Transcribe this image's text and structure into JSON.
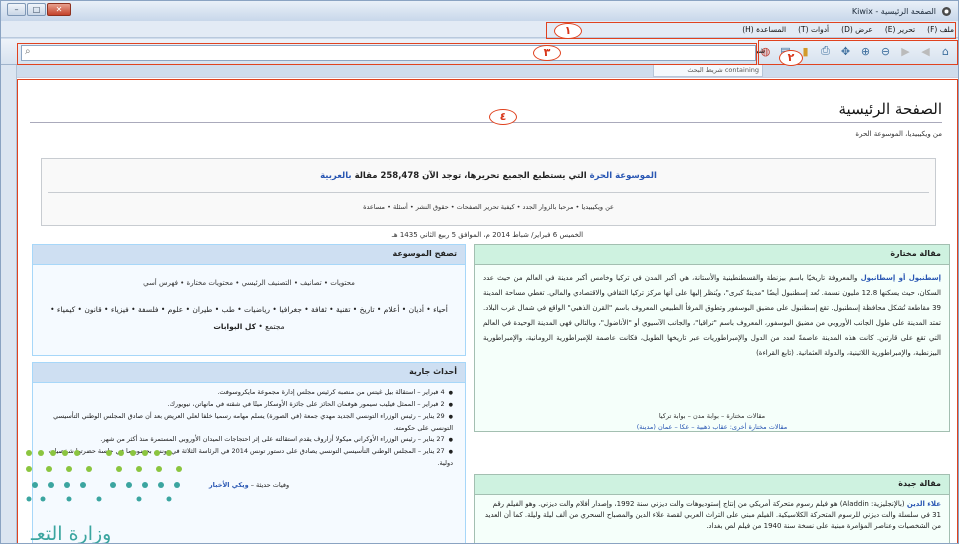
{
  "window": {
    "title": "الصفحة الرئيسية - Kiwix",
    "buttons": {
      "minimize": "–",
      "maximize": "□",
      "close": "✕"
    }
  },
  "menubar": {
    "items": [
      "ملف (F)",
      "تحرير (E)",
      "عرض (D)",
      "أدوات (T)",
      "المساعدة (H)"
    ]
  },
  "toolbar": {
    "search_label": "شريط البحث",
    "search_placeholder": "",
    "suggestion": "containing  شريط البحث"
  },
  "callouts": {
    "menu": "١",
    "toolbar": "٢",
    "search": "٣",
    "content": "٤"
  },
  "page": {
    "title": "الصفحة الرئيسية",
    "subtitle": "من ويكيبيديا، الموسوعة الحرة",
    "welcome": {
      "line1_link": "الموسوعة الحرة",
      "line1_text": "التي يستطيع الجميع تحريرها، توجد الآن 258,478 مقالة",
      "line1_lang": "بالعربية",
      "line2": "عن ويكيبيديا • مرحبا بالزوار الجدد • كيفية تحرير الصفحات • حقوق النشر • أسئلة • مساعدة"
    },
    "date": "الخميس 6 فبراير/ شباط 2014 م، الموافق 5 ربيع الثاني 1435 هـ"
  },
  "featured": {
    "header": "مقالة مختارة",
    "lead": "إسطنبول أو إسطانبول",
    "body": "والمعروفة تاريخيًا باسم بيزنطة والقسطنطينية والأستانة، هي أكبر المدن في تركيا وخامس أكبر مدينة في العالم من حيث عدد السكان، حيث يسكنها 12.8 مليون نسمة. تُعد إسطنبول أيضًا \"مدينةً كبرى\"، ويُنظر إليها على أنها مركز تركيا الثقافي والاقتصادي والمالي. تغطي مساحة المدينة 39 مقاطعة تُشكل محافظة إسطنبول. تقع إسطنبول على مضيق البوسفور وتطوق المرفأ الطبيعي المعروف باسم \"القرن الذهبي\" الواقع في شمال غرب البلاد. تمتد المدينة على طول الجانب الأوروبي من مضيق البوسفور، المعروف باسم \"تراقيا\"، والجانب الآسيوي أو \"الأناضول\"، وبالتالي فهي المدينة الوحيدة في العالم التي تقع على قارتين. كانت هذه المدينة عاصمةً لعدد من الدول والإمبراطوريات عبر تاريخها الطويل، فكانت عاصمة للإمبراطورية الرومانية، والإمبراطورية البيزنطية، والإمبراطورية اللاتينية، والدولة العثمانية. (تابع القراءة)",
    "links1": "مقالات مختارة – بوابة مدن – بوابة تركيا",
    "links2": "مقالات مختارة أخرى: عقاب ذهبية – عكا – عمان (مدينة)"
  },
  "good": {
    "header": "مقالة جيدة",
    "lead": "علاء الدين",
    "body": "(بالإنجليزية: Aladdin) هو فيلم رسوم متحركة أمريكي من إنتاج إستوديوهات والت ديزني سنة 1992، وإصدار أفلام والت ديزني. وهو الفيلم رقم 31 في سلسلة والت ديزني للرسوم المتحركة الكلاسيكية. الفيلم مبني على التراث العربي لقصة علاء الدين والمصباح السحري من ألف ليلة وليلة. كما أن العديد من الشخصيات وعناصر المؤامرة مبنية على نسخة سنة 1940 من فيلم لص بغداد."
  },
  "browse": {
    "header": "تصفح الموسوعة",
    "row1": "محتويات • تصانيف • التصنيف الرئيسي • محتويات مختارة • فهرس أسي",
    "row2": "أحياء • أديان • أعلام • تاريخ • تقنية • ثقافة • جغرافيا • رياضيات • طب • طيران • علوم • فلسفة • فيزياء • قانون • كيمياء • مجتمع •",
    "row2_bold": "كل البوابات"
  },
  "news": {
    "header": "أحداث جارية",
    "items": [
      "4 فبراير – استقالة بيل غيتس من منصبه كرئيس مجلس إدارة مجموعة مايكروسوفت.",
      "2 فبراير – الممثل فيليب سيمور هوفمان الحائز على جائزة الأوسكار ميتًا في شقته في مانهاتن، نيويورك.",
      "29 يناير – رئيس الوزراء التونسي الجديد مهدي جمعة (في الصورة) يسلم مهامه رسميا خلفا لعلي العريض بعد أن صادق المجلس الوطني التأسيسي التونسي على حكومته.",
      "27 يناير – رئيس الوزراء الأوكراني ميكولا أزاروف يقدم استقالته على إثر احتجاجات الميدان الأوروبي المستمرة منذ أكثر من شهر.",
      "27 يناير – المجلس الوطني التأسيسي التونسي يصادق على دستور تونس 2014 في الرئاسة الثلاثة في تونس بحضور ما في جلسة حضرتها شخصيات دولية."
    ],
    "footer_text": "وفيات حديثة –",
    "footer_link": "ويكي الأخبار"
  },
  "watermark": {
    "text": "وزارة التعـ"
  }
}
